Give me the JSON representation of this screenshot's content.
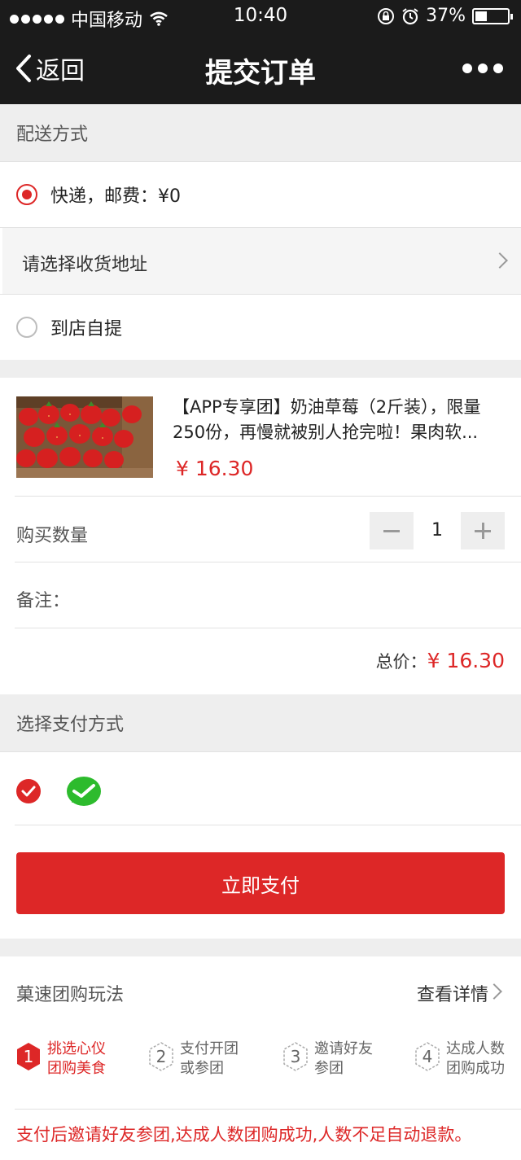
{
  "status": {
    "carrier": "中国移动",
    "time": "10:40",
    "battery": "37%",
    "battery_level": 0.37
  },
  "nav": {
    "back": "返回",
    "title": "提交订单"
  },
  "delivery": {
    "heading": "配送方式",
    "option_express": "快递，邮费：¥0",
    "address_placeholder": "请选择收货地址",
    "option_pickup": "到店自提"
  },
  "product": {
    "title": "【APP专享团】奶油草莓（2斤装），限量250份，再慢就被别人抢完啦！果肉软...",
    "price": "¥ 16.30"
  },
  "quantity": {
    "label": "购买数量",
    "value": "1"
  },
  "remark": {
    "label": "备注："
  },
  "total": {
    "label": "总价：",
    "value": "¥ 16.30"
  },
  "payment": {
    "heading": "选择支付方式",
    "pay_button": "立即支付"
  },
  "group": {
    "title": "菓速团购玩法",
    "details_link": "查看详情",
    "steps": [
      {
        "num": "1",
        "line1": "挑选心仪",
        "line2": "团购美食"
      },
      {
        "num": "2",
        "line1": "支付开团",
        "line2": "或参团"
      },
      {
        "num": "3",
        "line1": "邀请好友",
        "line2": "参团"
      },
      {
        "num": "4",
        "line1": "达成人数",
        "line2": "团购成功"
      }
    ],
    "notice": "支付后邀请好友参团,达成人数团购成功,人数不足自动退款。"
  },
  "colors": {
    "accent": "#dd2727",
    "wechat_green": "#2dbb2d",
    "header_bg": "#1b1b1b"
  }
}
